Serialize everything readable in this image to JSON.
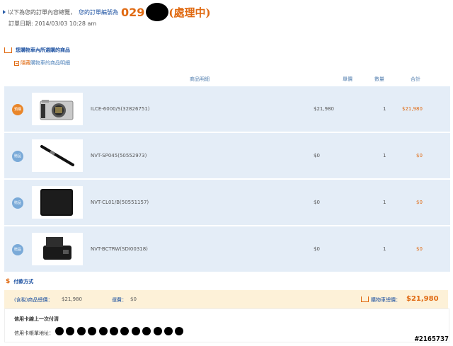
{
  "header": {
    "intro_text": "以下為您的訂單內容總覽，",
    "order_link_text": "您的訂單編號為",
    "order_number_prefix": "029",
    "order_status": "(處理中)",
    "order_date": "訂單日期: 2014/03/03 10:28 am"
  },
  "cart_section": {
    "title": "您購物車內所選購的商品",
    "toggle_link": "隱藏",
    "toggle_text": "購物車的商品明細"
  },
  "table": {
    "headers": [
      "商品明細",
      "單價",
      "數量",
      "合計"
    ],
    "rows": [
      {
        "badge": "預購",
        "badge_type": "main",
        "image_icon": "camera-body-icon",
        "sku": "ILCE-6000/S(32826751)",
        "price": "$21,980",
        "qty": "1",
        "subtotal": "$21,980"
      },
      {
        "badge": "贈品",
        "badge_type": "gift",
        "image_icon": "lens-pen-icon",
        "sku": "NVT-SP045(50552973)",
        "price": "$0",
        "qty": "1",
        "subtotal": "$0"
      },
      {
        "badge": "贈品",
        "badge_type": "gift",
        "image_icon": "cleaning-cloth-icon",
        "sku": "NVT-CL01/B(50551157)",
        "price": "$0",
        "qty": "1",
        "subtotal": "$0"
      },
      {
        "badge": "贈品",
        "badge_type": "gift",
        "image_icon": "battery-charger-icon",
        "sku": "NVT-BCTRW(SDI00318)",
        "price": "$0",
        "qty": "1",
        "subtotal": "$0"
      }
    ]
  },
  "payment": {
    "title": "付款方式",
    "goods_total_label": "(含稅)商品總價：",
    "goods_total_value": "$21,980",
    "shipping_label": "運費：",
    "shipping_value": "$0",
    "cart_total_label": "購物車總價：",
    "cart_total_value": "$21,980",
    "method": "信用卡線上一次付清",
    "billing_label": "信用卡帳單地址："
  },
  "watermark": "#2165737",
  "colors": {
    "accent": "#e06a12",
    "link": "#1a4fa0",
    "row_bg": "#e4edf7",
    "summary_bg": "#fdf1d8"
  }
}
